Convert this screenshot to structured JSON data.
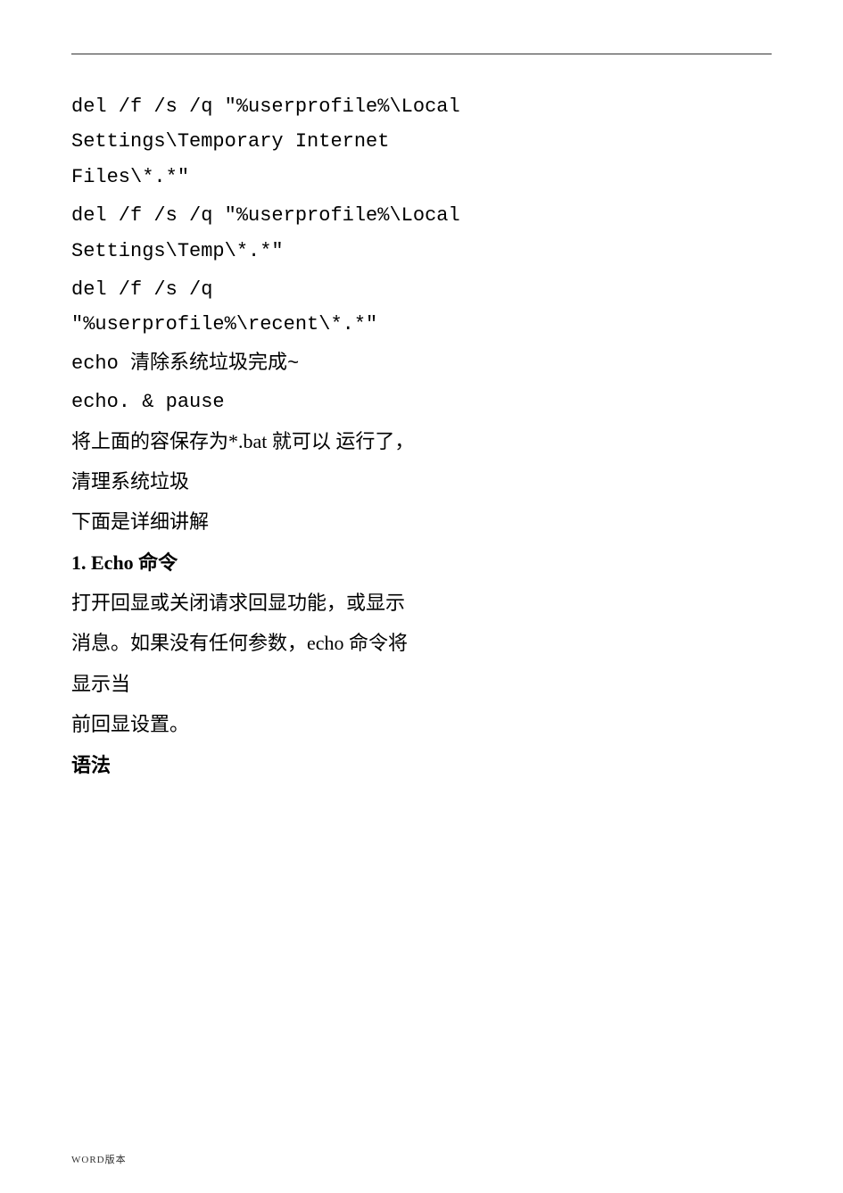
{
  "page": {
    "background": "#ffffff",
    "divider": true
  },
  "code_blocks": [
    {
      "id": "code1",
      "lines": [
        "del  /f  /s  /q  \"%userprofile%\\Local",
        "Settings\\Temporary          Internet",
        "Files\\*.*\""
      ]
    },
    {
      "id": "code2",
      "lines": [
        "del  /f  /s  /q  \"%userprofile%\\Local",
        "Settings\\Temp\\*.*\""
      ]
    },
    {
      "id": "code3",
      "lines": [
        "del         /f          /s          /q",
        "\"%userprofile%\\recent\\*.*\""
      ]
    },
    {
      "id": "code4",
      "lines": [
        "echo 清除系统垃圾完成~"
      ]
    },
    {
      "id": "code5",
      "lines": [
        "echo. & pause"
      ]
    }
  ],
  "text_sections": [
    {
      "id": "t1",
      "text": "将上面的容保存为*.bat 就可以 运行了，",
      "bold": false
    },
    {
      "id": "t2",
      "text": "清理系统垃圾",
      "bold": false
    },
    {
      "id": "t3",
      "text": "下面是详细讲解",
      "bold": false
    },
    {
      "id": "t4",
      "text": "1. Echo 命令",
      "bold": true
    },
    {
      "id": "t5",
      "text": "打开回显或关闭请求回显功能，或显示",
      "bold": false
    },
    {
      "id": "t6",
      "text": "消息。如果没有任何参数，echo 命令将",
      "bold": false
    },
    {
      "id": "t7",
      "text": "显示当",
      "bold": false
    },
    {
      "id": "t8",
      "text": "前回显设置。",
      "bold": false
    },
    {
      "id": "t9",
      "text": "语法",
      "bold": true
    }
  ],
  "footer": {
    "word_version_label": "WORD版本"
  }
}
